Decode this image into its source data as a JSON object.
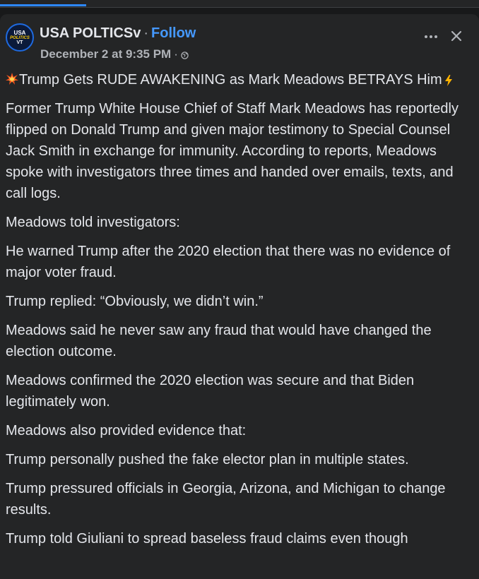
{
  "topbar": {
    "progress_fraction": 0.18
  },
  "header": {
    "avatar": {
      "line1": "USA",
      "line2": "POLITICS",
      "line3": "VT"
    },
    "page_name": "USA POLTICSv",
    "separator": "·",
    "follow_label": "Follow",
    "timestamp": "December 2 at 9:35 PM",
    "meta_separator": "·",
    "privacy_icon": "globe-icon",
    "more_icon": "more-options-icon",
    "close_icon": "close-icon"
  },
  "post": {
    "title_emoji": "collision-emoji",
    "title": "Trump Gets RUDE AWAKENING as Mark Meadows BETRAYS Him",
    "title_trailing_emoji": "lightning-emoji",
    "paragraphs": [
      "Former Trump White House Chief of Staff Mark Meadows has reportedly flipped on Donald Trump and given major testimony to Special Counsel Jack Smith in exchange for immunity. According to reports, Meadows spoke with investigators three times and handed over emails, texts, and call logs.",
      "Meadows told investigators:",
      "He warned Trump after the 2020 election that there was no evidence of major voter fraud.",
      "Trump replied: “Obviously, we didn’t win.”",
      "Meadows said he never saw any fraud that would have changed the election outcome.",
      "Meadows confirmed the 2020 election was secure and that Biden legitimately won.",
      "Meadows also provided evidence that:",
      "Trump personally pushed the fake elector plan in multiple states.",
      "Trump pressured officials in Georgia, Arizona, and Michigan to change results.",
      "Trump told Giuliani to spread baseless fraud claims even though"
    ]
  },
  "colors": {
    "background": "#18191a",
    "card": "#242526",
    "text_primary": "#e4e6eb",
    "text_secondary": "#b0b3b8",
    "link": "#4599ff"
  }
}
